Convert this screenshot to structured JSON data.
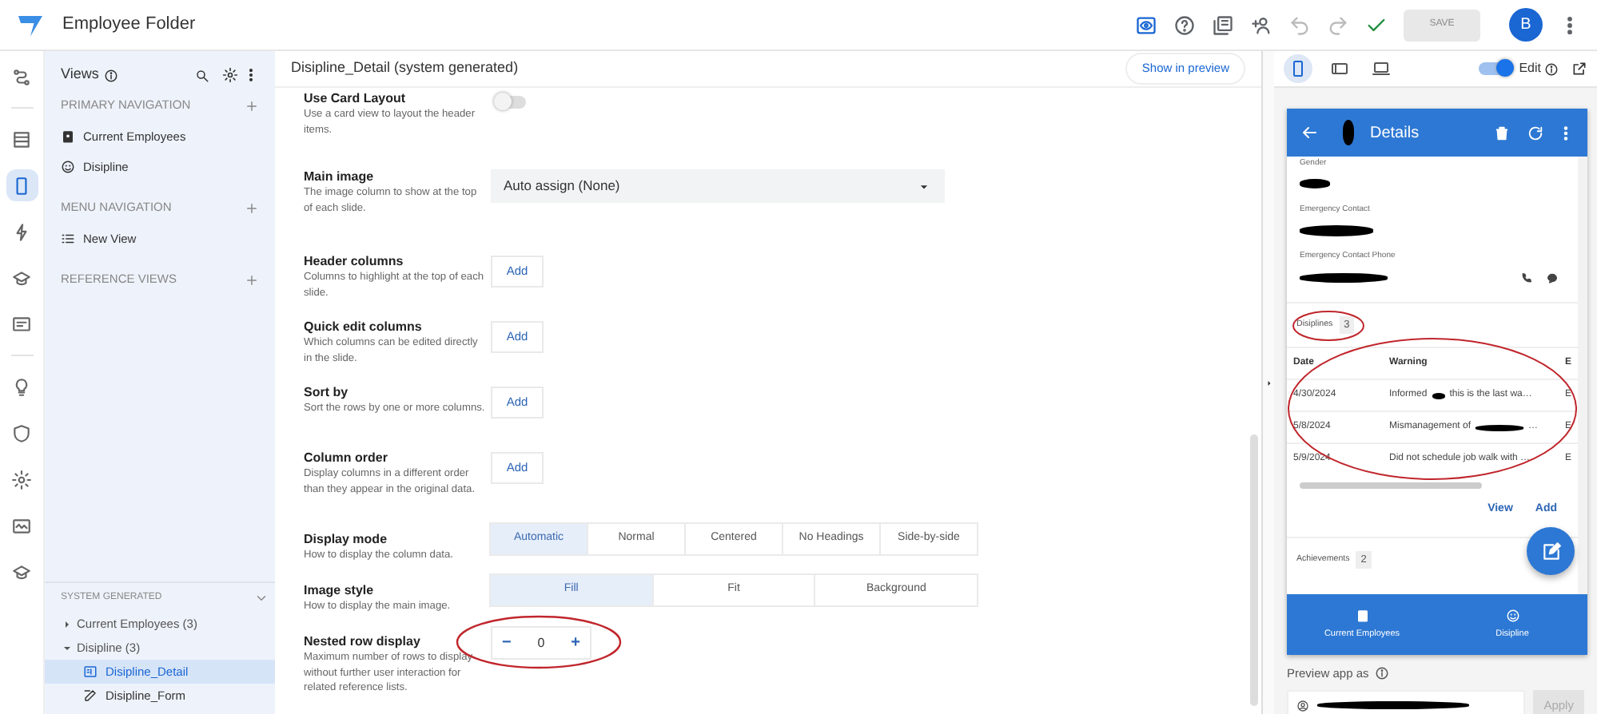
{
  "app": {
    "title": "Employee Folder",
    "save": {
      "label": "SAVE",
      "disabled": true
    },
    "avatar": "B"
  },
  "rail": [
    {
      "selected": false
    },
    {
      "selected": false
    },
    {
      "selected": true
    },
    {
      "selected": false
    },
    {
      "selected": false
    },
    {
      "selected": false
    },
    {
      "selected": false
    },
    {
      "selected": false
    },
    {
      "selected": false
    },
    {
      "selected": false
    },
    {
      "selected": false
    }
  ],
  "views_panel": {
    "title": "Views",
    "sections": [
      {
        "heading": "PRIMARY NAVIGATION",
        "items": [
          {
            "label": "Current Employees"
          },
          {
            "label": "Disipline"
          }
        ]
      },
      {
        "heading": "MENU NAVIGATION",
        "items": [
          {
            "label": "New View"
          }
        ]
      },
      {
        "heading": "REFERENCE VIEWS"
      }
    ]
  },
  "system_generated": {
    "heading": "SYSTEM GENERATED",
    "expanded": true,
    "tree": [
      {
        "label": "Current Employees (3)",
        "expanded": false
      },
      {
        "label": "Disipline (3)",
        "expanded": true,
        "children": [
          {
            "label": "Disipline_Detail",
            "selected": true
          },
          {
            "label": "Disipline_Form",
            "selected": false
          }
        ]
      }
    ]
  },
  "editor": {
    "title": "Disipline_Detail (system generated)",
    "preview_button": "Show in preview",
    "settings": [
      {
        "kind": "toggle",
        "label": "Use Card Layout",
        "description": "Use a card view to layout the header items.",
        "on": false
      },
      {
        "kind": "dropdown",
        "label": "Main image",
        "description": "The image column to show at the top of each slide.",
        "value": "Auto assign (None)"
      },
      {
        "kind": "add",
        "label": "Header columns",
        "description": "Columns to highlight at the top of each slide.",
        "button": "Add"
      },
      {
        "kind": "add",
        "label": "Quick edit columns",
        "description": "Which columns can be edited directly in the slide.",
        "button": "Add"
      },
      {
        "kind": "add",
        "label": "Sort by",
        "description": "Sort the rows by one or more columns.",
        "button": "Add"
      },
      {
        "kind": "add",
        "label": "Column order",
        "description": "Display columns in a different order than they appear in the original data.",
        "button": "Add"
      },
      {
        "kind": "segmented",
        "label": "Display mode",
        "description": "How to display the column data.",
        "options": [
          {
            "label": "Automatic",
            "selected": true
          },
          {
            "label": "Normal",
            "selected": false
          },
          {
            "label": "Centered",
            "selected": false
          },
          {
            "label": "No Headings",
            "selected": false
          },
          {
            "label": "Side-by-side",
            "selected": false
          }
        ]
      },
      {
        "kind": "segmented",
        "label": "Image style",
        "description": "How to display the main image.",
        "options": [
          {
            "label": "Fill",
            "selected": true
          },
          {
            "label": "Fit",
            "selected": false
          },
          {
            "label": "Background",
            "selected": false
          }
        ]
      },
      {
        "kind": "stepper",
        "label": "Nested row display",
        "description": "Maximum number of rows to display without further user interaction for related reference lists.",
        "value": "0",
        "minus": "−",
        "plus": "+"
      }
    ]
  },
  "preview": {
    "devices": [
      {
        "selected": true
      },
      {
        "selected": false
      },
      {
        "selected": false
      }
    ],
    "edit_toggle": {
      "label": "Edit",
      "on": true
    },
    "app_header": {
      "title": "Details"
    },
    "fields": [
      {
        "label": "Gender"
      },
      {
        "label": "Emergency Contact"
      },
      {
        "label": "Emergency Contact Phone"
      }
    ],
    "related": {
      "label": "Disiplines",
      "count": "3",
      "columns": [
        "Date",
        "Warning",
        "E"
      ],
      "rows": [
        {
          "date": "4/30/2024",
          "warning": "Informed",
          "redacted": true,
          "warning_after": "this is the last wa…",
          "extra": "E"
        },
        {
          "date": "5/8/2024",
          "warning": "Mismanagement of",
          "redacted": true,
          "warning_after": "…",
          "extra": "E"
        },
        {
          "date": "5/9/2024",
          "warning": "Did not schedule job walk with …",
          "redacted": false,
          "extra": "E"
        }
      ],
      "actions": [
        "View",
        "Add"
      ]
    },
    "related_2": {
      "label": "Achievements",
      "count": "2"
    },
    "bottom_nav": [
      {
        "label": "Current Employees"
      },
      {
        "label": "Disipline"
      }
    ],
    "preview_as": {
      "label": "Preview app as",
      "button": "Apply"
    }
  }
}
